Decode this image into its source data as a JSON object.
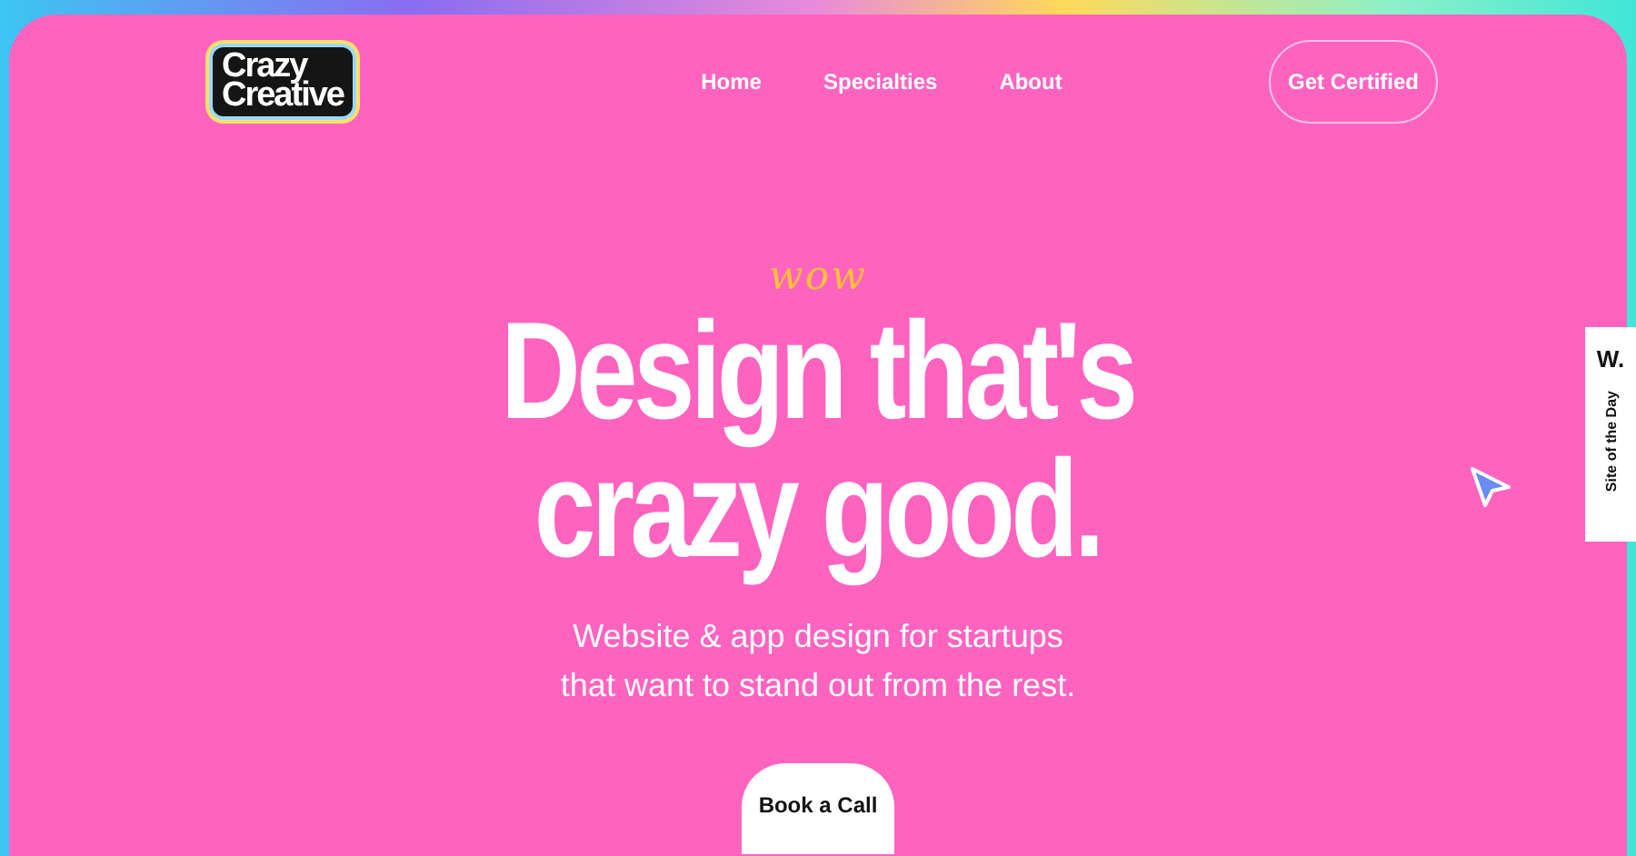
{
  "logo": {
    "lines": [
      "Crazy",
      "Creative"
    ]
  },
  "nav": {
    "links": [
      "Home",
      "Specialties",
      "About"
    ],
    "cta": "Get Certified"
  },
  "hero": {
    "eyebrow": "wow",
    "headline": [
      "Design that's",
      "crazy good."
    ],
    "subtitle": [
      "Website & app design for startups",
      "that want to stand out from the rest."
    ],
    "button": "Book a Call"
  },
  "award_badge": {
    "mark": "W.",
    "label": "Site of the Day"
  }
}
